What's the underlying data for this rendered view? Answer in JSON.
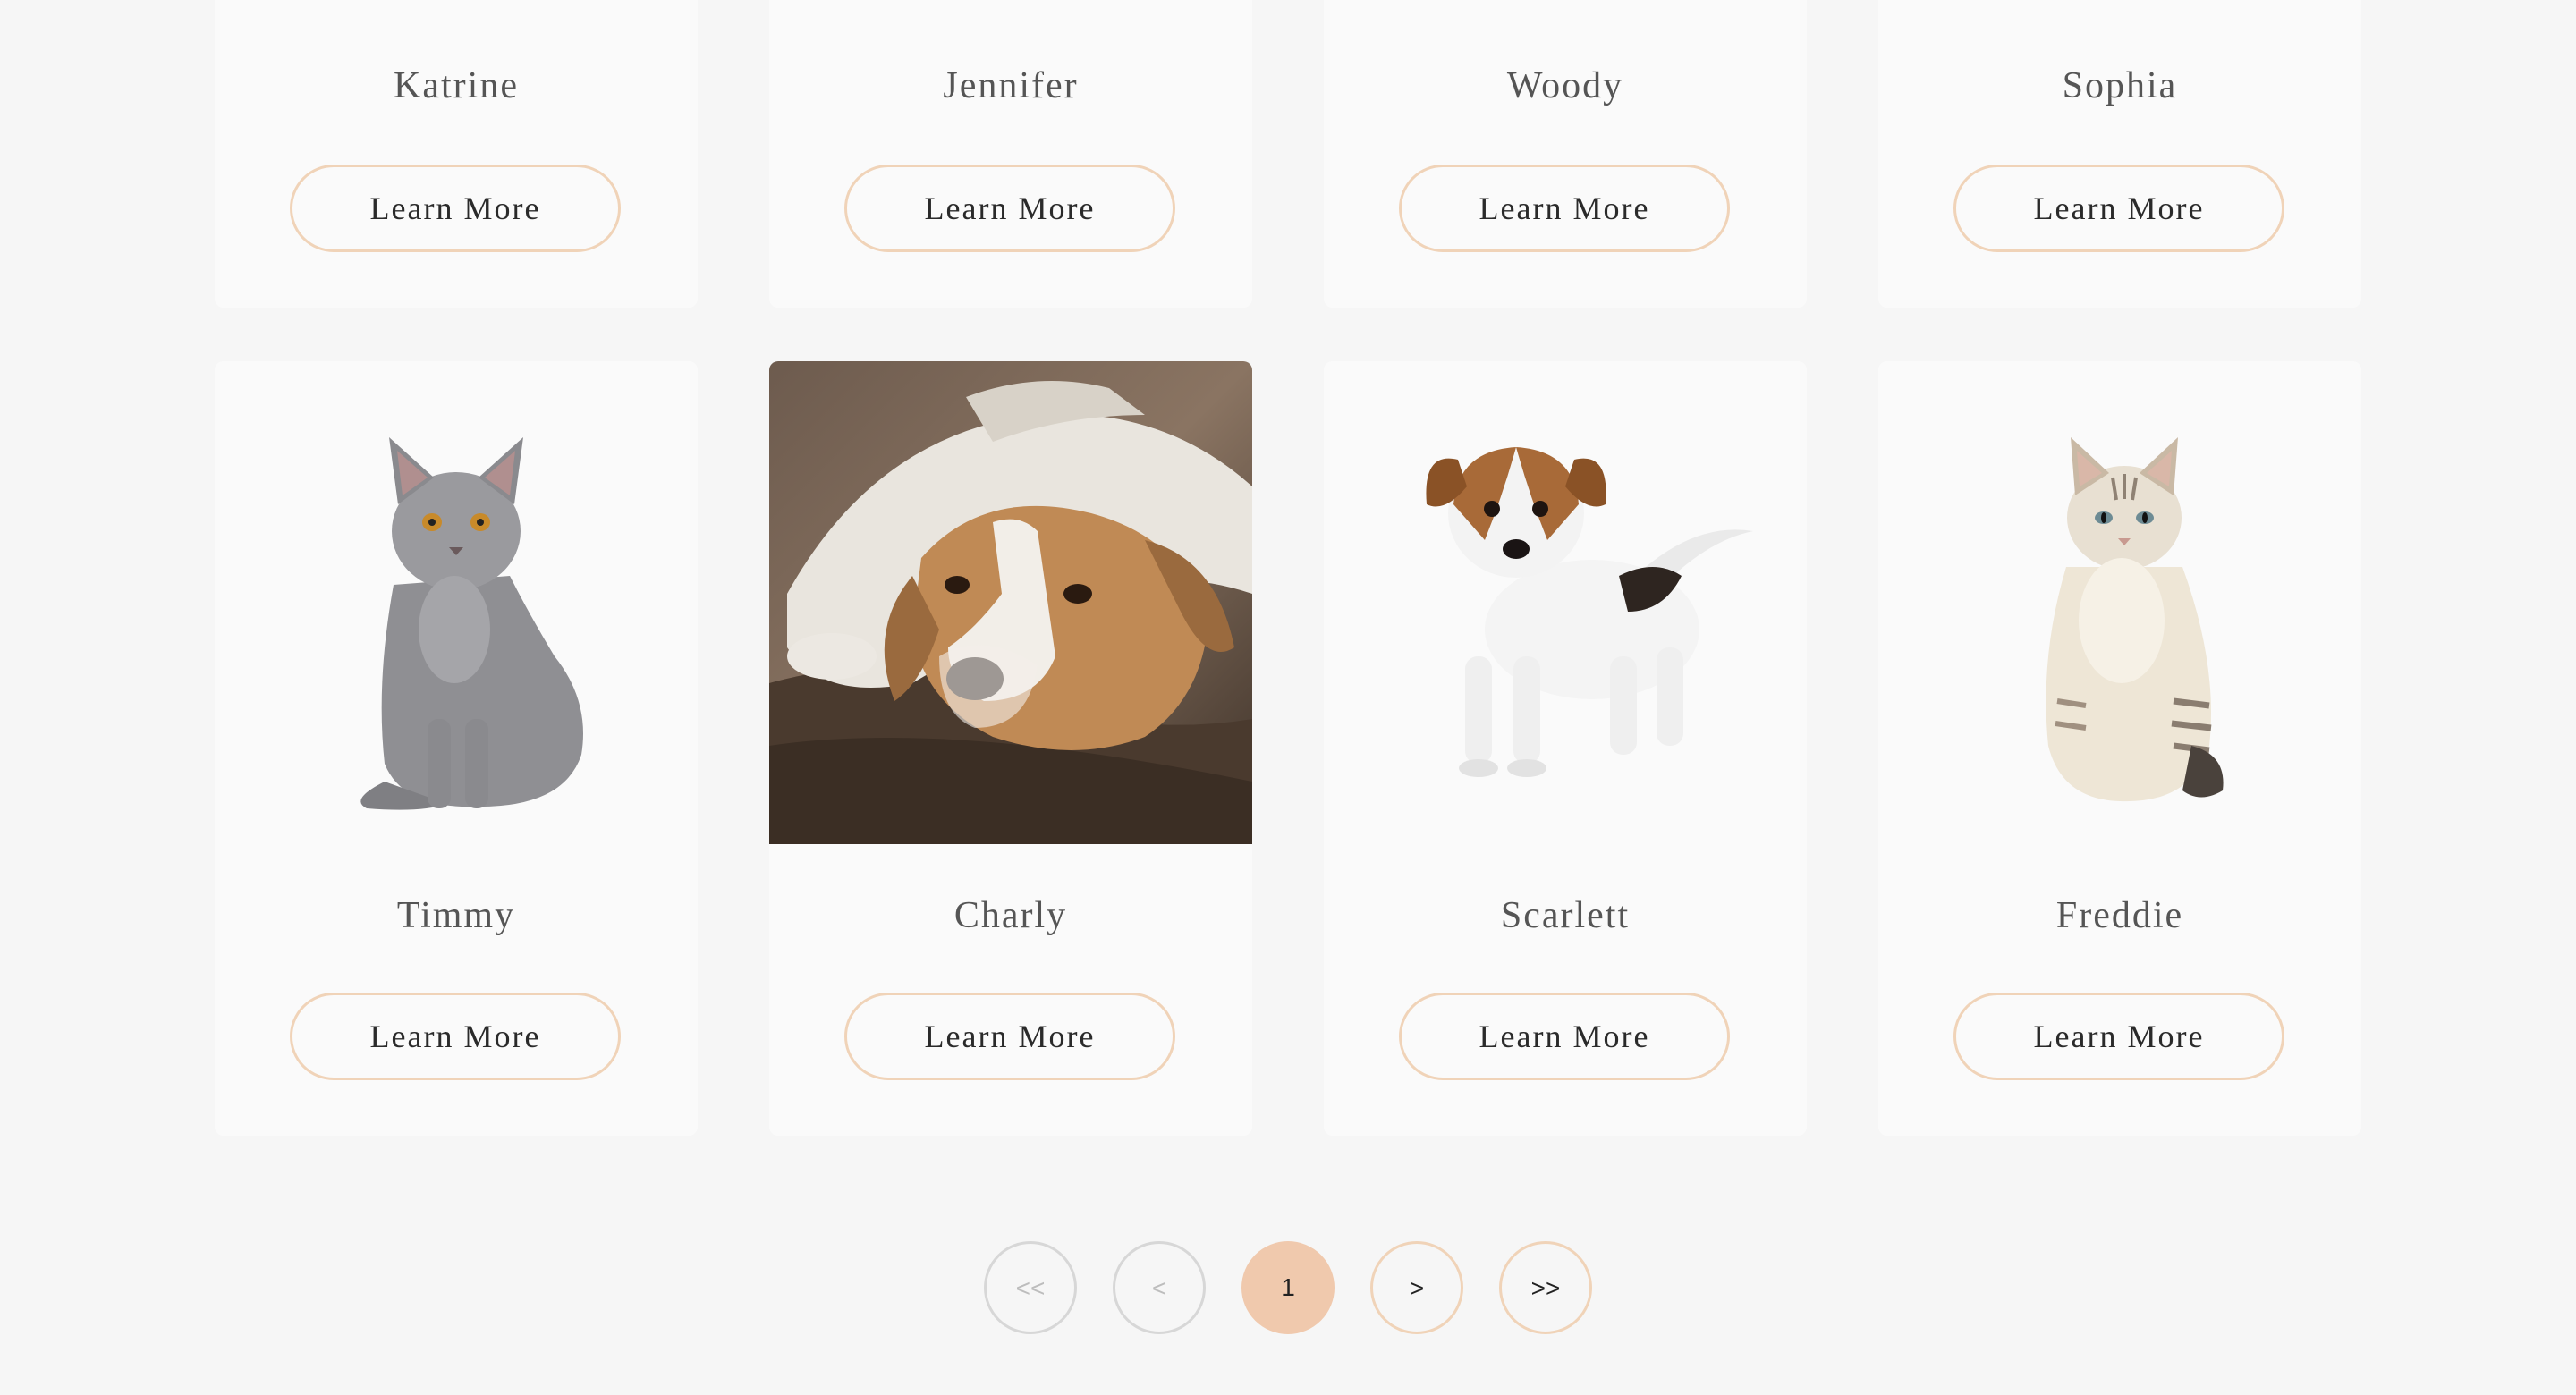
{
  "pets_row_top": [
    {
      "name": "Katrine",
      "button": "Learn More"
    },
    {
      "name": "Jennifer",
      "button": "Learn More"
    },
    {
      "name": "Woody",
      "button": "Learn More"
    },
    {
      "name": "Sophia",
      "button": "Learn More"
    }
  ],
  "pets_row_bottom": [
    {
      "name": "Timmy",
      "button": "Learn More",
      "image": "grey-cat-photo"
    },
    {
      "name": "Charly",
      "button": "Learn More",
      "image": "dog-lying-photo"
    },
    {
      "name": "Scarlett",
      "button": "Learn More",
      "image": "puppy-photo"
    },
    {
      "name": "Freddie",
      "button": "Learn More",
      "image": "tabby-cat-photo"
    }
  ],
  "pagination": {
    "first": "<<",
    "prev": "<",
    "current": "1",
    "next": ">",
    "last": ">>"
  },
  "colors": {
    "background": "#f6f6f6",
    "card": "#fafafa",
    "accent_border": "#f0d3b8",
    "active_page": "#f0c9ad"
  }
}
